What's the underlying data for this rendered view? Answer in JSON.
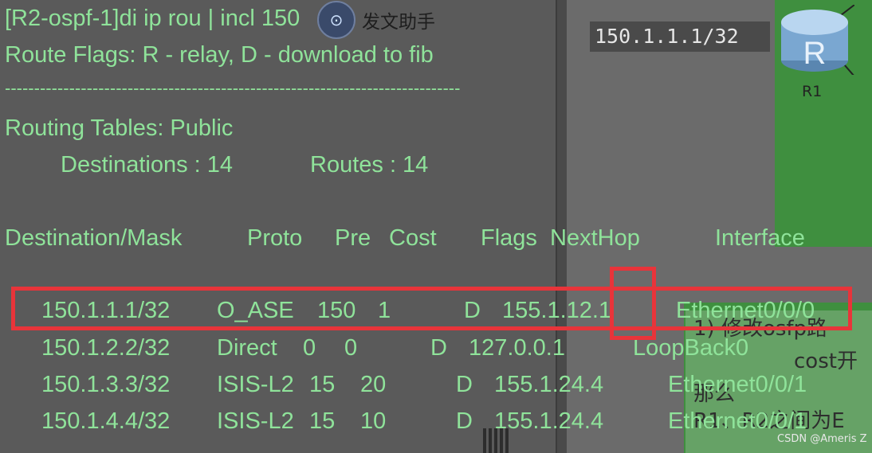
{
  "terminal": {
    "command": "[R2-ospf-1]di ip rou | incl 150",
    "flags_line": "Route Flags: R - relay, D - download to fib",
    "separator": "------------------------------------------------------------------------------",
    "tables_title": "Routing Tables: Public",
    "destinations_label": "Destinations : 14",
    "routes_label": "Routes : 14",
    "headers": [
      "Destination/Mask",
      "Proto",
      "Pre",
      "Cost",
      "Flags",
      "NextHop",
      "Interface"
    ],
    "rows": [
      {
        "dest": "150.1.1.1/32",
        "proto": "O_ASE",
        "pre": "150",
        "cost": "1",
        "flags": "D",
        "nexthop": "155.1.12.1",
        "iface": "Ethernet0/0/0"
      },
      {
        "dest": "150.1.2.2/32",
        "proto": "Direct",
        "pre": "0",
        "cost": "0",
        "flags": "D",
        "nexthop": "127.0.0.1",
        "iface": "LoopBack0"
      },
      {
        "dest": "150.1.3.3/32",
        "proto": "ISIS-L2",
        "pre": "15",
        "cost": "20",
        "flags": "D",
        "nexthop": "155.1.24.4",
        "iface": "Ethernet0/0/1"
      },
      {
        "dest": "150.1.4.4/32",
        "proto": "ISIS-L2",
        "pre": "15",
        "cost": "10",
        "flags": "D",
        "nexthop": "155.1.24.4",
        "iface": "Ethernet0/0/1"
      }
    ]
  },
  "assistant": {
    "label": "发文助手",
    "icon": "chat-assistant-icon"
  },
  "topology": {
    "ip_tag": "150.1.1.1/32",
    "router_label": "R1",
    "router_icon": "router-icon",
    "router_glyph": "R"
  },
  "notes": {
    "line1": "1) 修改osfp路",
    "line2": "cost开",
    "line3": "那么",
    "line4": "R1、R2之间为E"
  },
  "watermark": "CSDN @Ameris Z",
  "colors": {
    "terminal_text": "#8fe39a",
    "highlight": "#e8343a",
    "green_panel": "#3f8f3f"
  }
}
